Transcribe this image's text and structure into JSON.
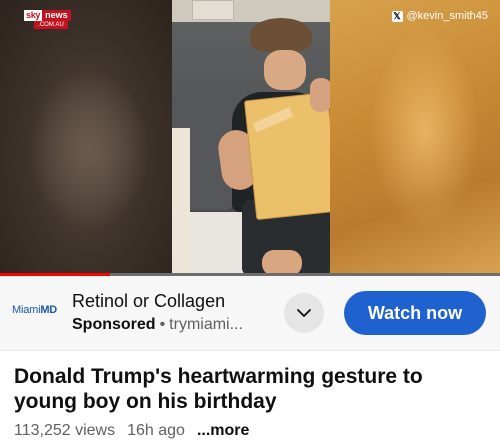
{
  "video": {
    "logo": {
      "brand": "sky",
      "network": "news",
      "domain": ".COM.AU"
    },
    "watermark": {
      "icon": "x-logo-icon",
      "handle": "@kevin_smith45"
    },
    "progress_fraction": 0.22,
    "colors": {
      "progress": "#ff0000",
      "track": "#6d6d6d"
    }
  },
  "ad": {
    "advertiser_logo": {
      "part1": "Miami",
      "part2": "MD"
    },
    "title": "Retinol or Collagen",
    "sponsored_label": "Sponsored",
    "separator": "•",
    "domain": "trymiami...",
    "more_icon": "chevron-down-icon",
    "cta_label": "Watch now",
    "colors": {
      "cta": "#1f62cf"
    }
  },
  "video_info": {
    "title": "Donald Trump's heartwarming gesture to young boy on his birthday",
    "views": "113,252 views",
    "age": "16h ago",
    "more_label": "...more"
  }
}
